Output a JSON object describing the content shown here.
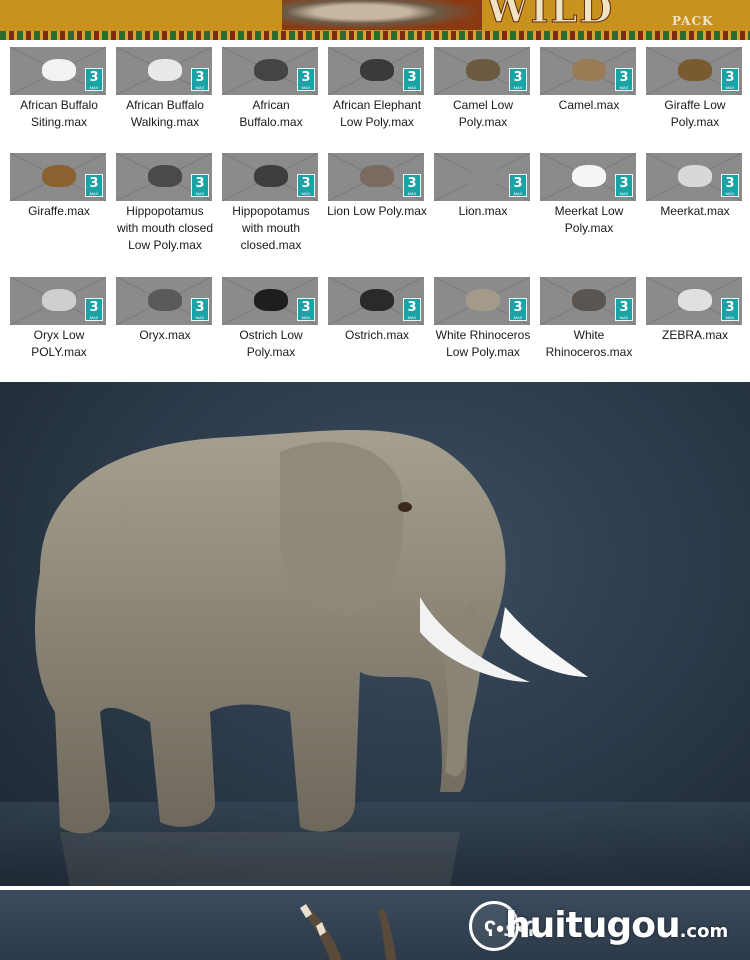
{
  "banner": {
    "title": "WILD AFRICA",
    "subtitle": "PACK"
  },
  "thumbnail_badge": {
    "text": "3",
    "subtext": "MAX"
  },
  "files": [
    {
      "label": "African Buffalo Siting.max",
      "color": "#f2f2f2"
    },
    {
      "label": "African Buffalo Walking.max",
      "color": "#e9e9e9"
    },
    {
      "label": "African Buffalo.max",
      "color": "#444444"
    },
    {
      "label": "African Elephant Low Poly.max",
      "color": "#3a3a3a"
    },
    {
      "label": "Camel Low Poly.max",
      "color": "#6b5a40"
    },
    {
      "label": "Camel.max",
      "color": "#9a7b55"
    },
    {
      "label": "Giraffe Low Poly.max",
      "color": "#7a5a30"
    },
    {
      "label": "Giraffe.max",
      "color": "#8a6230"
    },
    {
      "label": "Hippopotamus with mouth closed Low Poly.max",
      "color": "#4a4a4a"
    },
    {
      "label": "Hippopotamus with mouth closed.max",
      "color": "#3e3e3e"
    },
    {
      "label": "Lion Low Poly.max",
      "color": "#7a6a60"
    },
    {
      "label": "Lion.max",
      "color": "#8a8a8a"
    },
    {
      "label": "Meerkat Low Poly.max",
      "color": "#f5f5f5"
    },
    {
      "label": "Meerkat.max",
      "color": "#d8d8d8"
    },
    {
      "label": "Oryx Low POLY.max",
      "color": "#cfcfcf"
    },
    {
      "label": "Oryx.max",
      "color": "#5a5a5a"
    },
    {
      "label": "Ostrich Low Poly.max",
      "color": "#1e1e1e"
    },
    {
      "label": "Ostrich.max",
      "color": "#2a2a2a"
    },
    {
      "label": "White Rhinoceros Low Poly.max",
      "color": "#a39a8a"
    },
    {
      "label": "White Rhinoceros.max",
      "color": "#5a5550"
    },
    {
      "label": "ZEBRA.max",
      "color": "#e0e0e0"
    }
  ],
  "watermark": {
    "brand": "huitugou",
    "suffix": ".com"
  }
}
